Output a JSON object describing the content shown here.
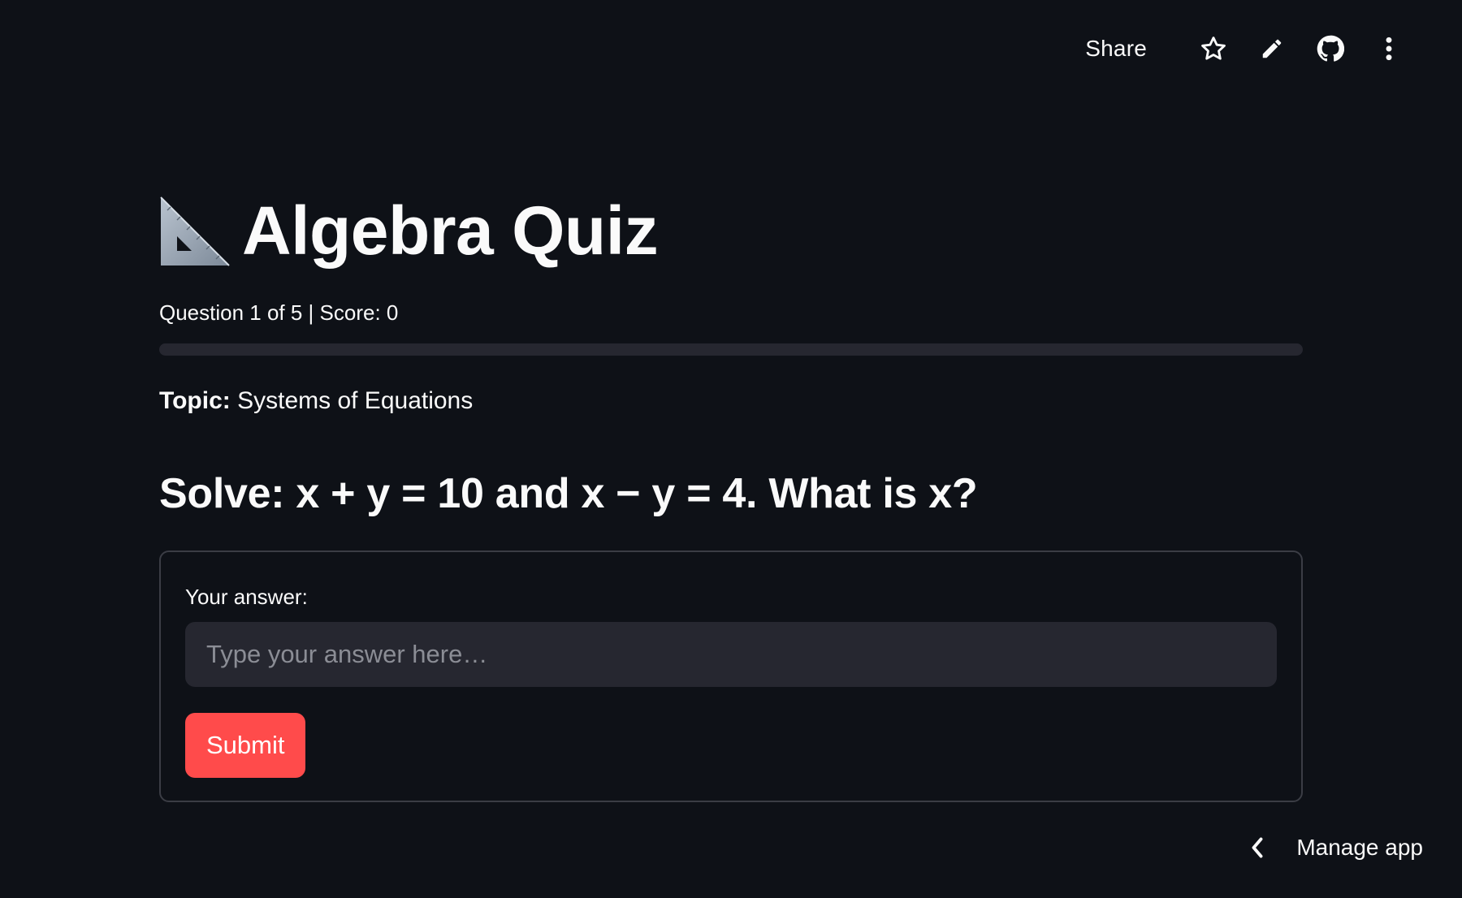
{
  "toolbar": {
    "share_label": "Share",
    "icons": [
      "star-icon",
      "pencil-icon",
      "github-icon",
      "more-vertical-icon"
    ]
  },
  "header": {
    "title": "Algebra Quiz",
    "icon": "triangular-ruler-icon"
  },
  "progress": {
    "text": "Question 1 of 5 | Score: 0",
    "fraction": 0.0
  },
  "topic": {
    "label": "Topic:",
    "value": " Systems of Equations"
  },
  "question": {
    "text": "Solve: x + y = 10 and x − y = 4. What is x?"
  },
  "form": {
    "answer_label": "Your answer:",
    "answer_value": "",
    "answer_placeholder": "Type your answer here…",
    "submit_label": "Submit"
  },
  "footer": {
    "manage_app_label": "Manage app"
  },
  "colors": {
    "background": "#0e1117",
    "accent": "#ff4b4b",
    "input_bg": "#262730",
    "border": "#3b3d45"
  }
}
